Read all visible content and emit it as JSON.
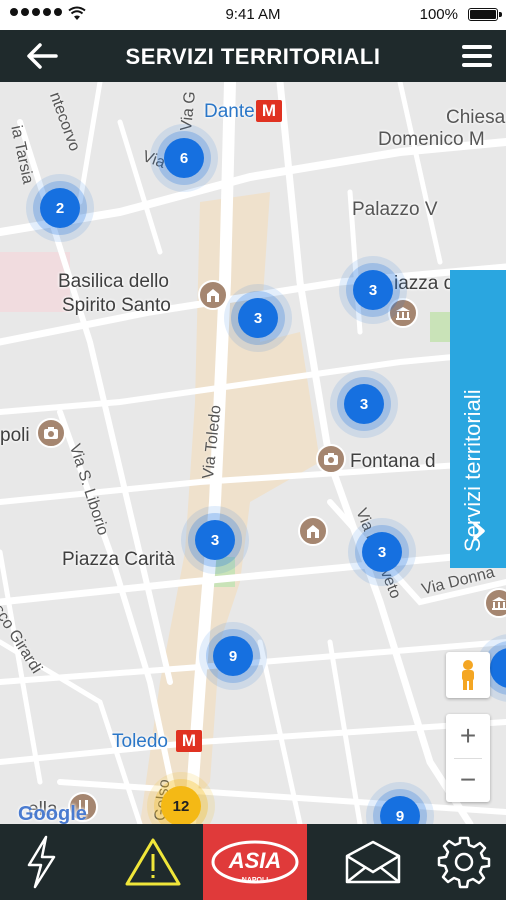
{
  "status_bar": {
    "time": "9:41 AM",
    "battery": "100%",
    "battery_level": 1.0
  },
  "header": {
    "title": "SERVIZI TERRITORIALI"
  },
  "map": {
    "labels": {
      "dante": "Dante",
      "chiesa": "Chiesa",
      "domenico": "Domenico M",
      "palazzo": "Palazzo V",
      "basilica1": "Basilica dello",
      "basilica2": "Spirito Santo",
      "piazza_d": "iazza d",
      "poli": "poli",
      "fontana": "Fontana d",
      "piazza_carita": "Piazza Carità",
      "toledo": "Toledo",
      "via_toledo": "Via Toledo",
      "via_s_liborio": "Via S. Liborio",
      "via_tarsia": "ia Tarsia",
      "montecorvo": "ntecorvo",
      "via_sia": "Via  sia",
      "via_g": "Via G",
      "via_donna": "Via Donna",
      "via_monteoliveto": "Via  nteoliveto",
      "gelso": "Gelso",
      "co_girardi": "sco Girardi",
      "ella": "ella",
      "google": "Google"
    },
    "clusters": [
      {
        "count": "6",
        "color": "blue"
      },
      {
        "count": "2",
        "color": "blue"
      },
      {
        "count": "3",
        "color": "blue"
      },
      {
        "count": "3",
        "color": "blue"
      },
      {
        "count": "3",
        "color": "blue"
      },
      {
        "count": "3",
        "color": "blue"
      },
      {
        "count": "3",
        "color": "blue"
      },
      {
        "count": "9",
        "color": "blue"
      },
      {
        "count": "12",
        "color": "yellow"
      },
      {
        "count": "9",
        "color": "blue"
      }
    ],
    "metro_letter": "M",
    "side_tab": "Servizi territoriali",
    "zoom_in": "+",
    "zoom_out": "−"
  },
  "bottom_nav": {
    "items": [
      {
        "icon": "lightning-icon"
      },
      {
        "icon": "warning-icon"
      },
      {
        "icon": "asia-napoli-logo",
        "logo_text": "ASIA",
        "logo_sub": "NAPOLI"
      },
      {
        "icon": "envelope-icon"
      },
      {
        "icon": "gear-icon"
      }
    ]
  },
  "colors": {
    "header_bg": "#1f2a2c",
    "cluster_blue": "#1670e0",
    "cluster_yellow": "#f4b915",
    "side_tab": "#2aa6e0",
    "asia_red": "#e03a3a"
  }
}
